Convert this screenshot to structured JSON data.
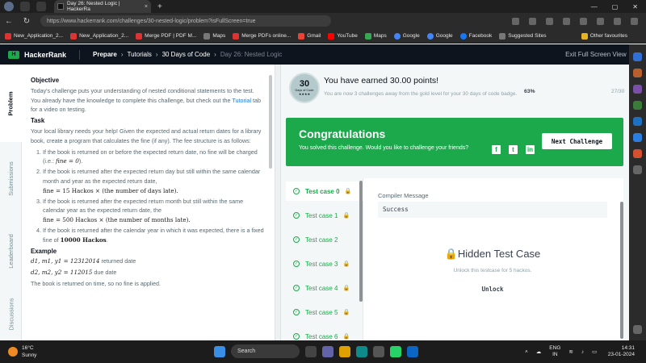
{
  "browser": {
    "tab_title": "Day 26: Nested Logic | HackerRa",
    "tab_close": "×",
    "new_tab": "+",
    "url": "https://www.hackerrank.com/challenges/30-nested-logic/problem?isFullScreen=true",
    "back": "←",
    "refresh": "↻",
    "window_controls": [
      "—",
      "▢",
      "✕"
    ],
    "bookmarks": [
      "New_Application_2...",
      "New_Application_2...",
      "Merge PDF | PDF M...",
      "Maps",
      "Merge PDFs online...",
      "Gmail",
      "YouTube",
      "Maps",
      "Google",
      "Google",
      "Facebook",
      "Suggested Sites"
    ],
    "other_favourites": "Other favourites"
  },
  "header": {
    "logo_mark": "H",
    "logo": "HackerRank",
    "prepare": "Prepare",
    "arrow": "›",
    "tutorials": "Tutorials",
    "course": "30 Days of Code",
    "current": "Day 26: Nested Logic",
    "exit": "Exit Full Screen View",
    "exit_icon": "⤡"
  },
  "vtabs": {
    "problem": "Problem",
    "submissions": "Submissions",
    "leaderboard": "Leaderboard",
    "discussions": "Discussions"
  },
  "problem": {
    "objective_h": "Objective",
    "objective_1": "Today's challenge puts your understanding of nested conditional statements to the test. You already have the knowledge to complete this challenge, but check out the ",
    "tutorial_link": "Tutorial",
    "objective_2": " tab for a video on testing.",
    "task_h": "Task",
    "task": "Your local library needs your help! Given the expected and actual return dates for a library book, create a program that calculates the fine (if any). The fee structure is as follows:",
    "rule1": "If the book is returned on or before the expected return date, no fine will be charged (i.e.: ",
    "rule1_math": "fine = 0",
    "rule1_end": ").",
    "rule2": "If the book is returned after the expected return day but still within the same calendar month and year as the expected return date,",
    "rule2_math": "fine = 15 Hackos × (the number of days late).",
    "rule3": "If the book is returned after the expected return month but still within the same calendar year as the expected return date, the",
    "rule3_math": "fine = 500 Hackos × (the number of months late).",
    "rule4": "If the book is returned after the calendar year in which it was expected, there is a fixed fine of ",
    "rule4_math": "10000 Hackos",
    "rule4_end": ".",
    "example_h": "Example",
    "ex1_math": "d1, m1, y1 = 12312014",
    "ex1_label": " returned date",
    "ex2_math": "d2, m2, y2 = 112015",
    "ex2_label": " due date",
    "ex_note": "The book is returned on time, so no fine is applied."
  },
  "badge": {
    "num": "30",
    "sub": "Days of Code",
    "stars": "★★★★"
  },
  "earned": {
    "title": "You have earned 30.00 points!",
    "subtitle": "You are now 3 challenges away from the gold level for your 30 days of code badge.",
    "percent": "63%",
    "percent_value": 0.63,
    "progress": "27/30"
  },
  "congrats": {
    "title": "Congratulations",
    "subtitle": "You solved this challenge. Would you like to challenge your friends?",
    "facebook_icon": "f",
    "twitter_icon": "t",
    "linkedin_icon": "in",
    "button": "Next Challenge"
  },
  "results": {
    "check_icon": "✓",
    "lock_icon": "🔒",
    "testcases": [
      {
        "label": "Test case 0",
        "locked": true
      },
      {
        "label": "Test case 1",
        "locked": true
      },
      {
        "label": "Test case 2",
        "locked": false
      },
      {
        "label": "Test case 3",
        "locked": true
      },
      {
        "label": "Test case 4",
        "locked": true
      },
      {
        "label": "Test case 5",
        "locked": true
      },
      {
        "label": "Test case 6",
        "locked": true
      }
    ],
    "compiler_label": "Compiler Message",
    "compiler_output": "Success",
    "hidden_title": "🔒Hidden Test Case",
    "hidden_sub": "Unlock this testcase for 5 hackos.",
    "unlock": "Unlock"
  },
  "taskbar": {
    "temp": "16°C",
    "weather": "Sunny",
    "search": "Search",
    "lang_1": "ENG",
    "lang_2": "IN",
    "time": "14:31",
    "date": "23-01-2024"
  }
}
